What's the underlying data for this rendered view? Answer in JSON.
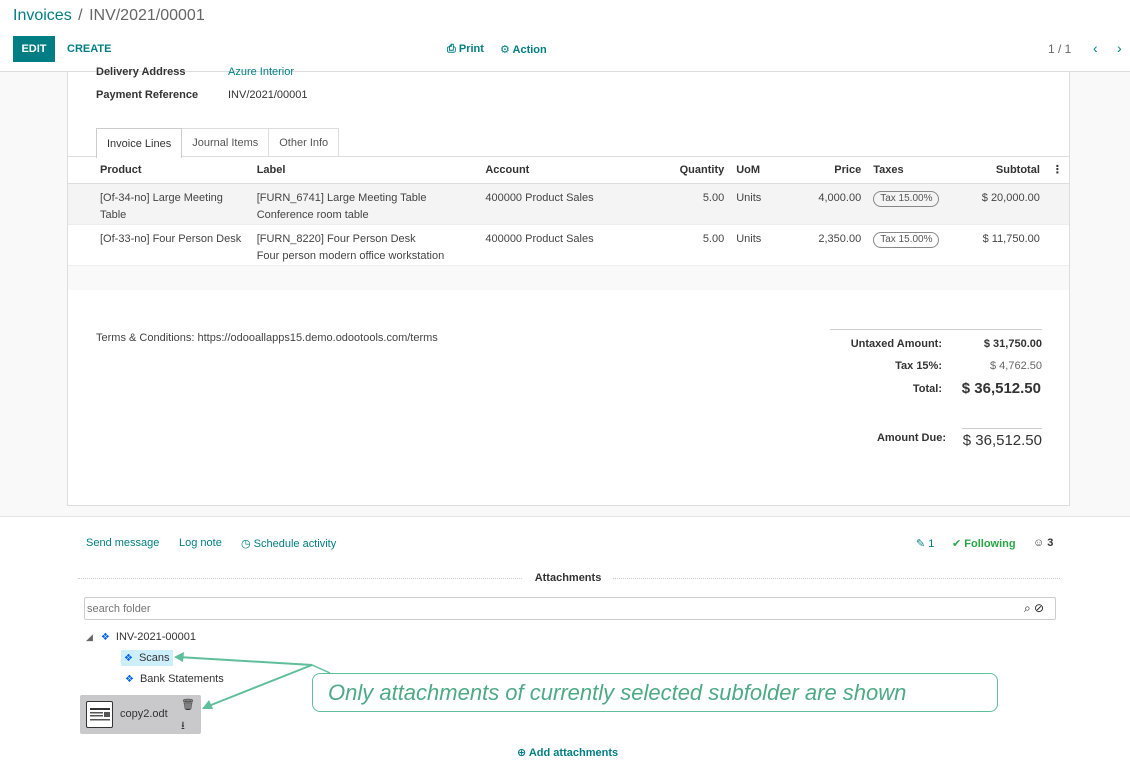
{
  "breadcrumb": {
    "parent": "Invoices",
    "sep": "/",
    "current": "INV/2021/00001"
  },
  "toolbar": {
    "edit": "EDIT",
    "create": "CREATE",
    "print": "⎙ Print",
    "action": "⚙ Action"
  },
  "pager": {
    "text": "1 / 1",
    "prev": "‹",
    "next": "›"
  },
  "fields": {
    "delivery_label": "Delivery Address",
    "delivery_value": "Azure Interior",
    "payref_label": "Payment Reference",
    "payref_value": "INV/2021/00001"
  },
  "tabs": [
    "Invoice Lines",
    "Journal Items",
    "Other Info"
  ],
  "columns": {
    "product": "Product",
    "label": "Label",
    "account": "Account",
    "quantity": "Quantity",
    "uom": "UoM",
    "price": "Price",
    "taxes": "Taxes",
    "subtotal": "Subtotal",
    "more": "⋮"
  },
  "lines": [
    {
      "product": "[Of-34-no] Large Meeting Table",
      "label1": "[FURN_6741] Large Meeting Table",
      "label2": "Conference room table",
      "account": "400000 Product Sales",
      "quantity": "5.00",
      "uom": "Units",
      "price": "4,000.00",
      "tax": "Tax 15.00%",
      "subtotal": "$ 20,000.00"
    },
    {
      "product": "[Of-33-no] Four Person Desk",
      "label1": "[FURN_8220] Four Person Desk",
      "label2": "Four person modern office workstation",
      "account": "400000 Product Sales",
      "quantity": "5.00",
      "uom": "Units",
      "price": "2,350.00",
      "tax": "Tax 15.00%",
      "subtotal": "$ 11,750.00"
    }
  ],
  "terms": "Terms & Conditions: https://odooallapps15.demo.odootools.com/terms",
  "totals": {
    "untaxed_label": "Untaxed Amount:",
    "untaxed_value": "$ 31,750.00",
    "tax_label": "Tax 15%:",
    "tax_value": "$ 4,762.50",
    "total_label": "Total:",
    "total_value": "$ 36,512.50",
    "due_label": "Amount Due:",
    "due_value": "$ 36,512.50"
  },
  "chatter": {
    "send_message": "Send message",
    "log_note": "Log note",
    "schedule_activity": "◷ Schedule activity",
    "attachments_count": "✎ 1",
    "following": "✔ Following",
    "followers": "☺ 3"
  },
  "attachments": {
    "title": "Attachments",
    "search_placeholder": "search folder",
    "search_icons": "⌕ ⊘",
    "root": "INV-2021-00001",
    "children": [
      "Scans",
      "Bank Statements"
    ],
    "file_name": "copy2.odt",
    "add_label": "⊕ Add attachments"
  },
  "callout": "Only attachments of currently selected subfolder are shown",
  "colors": {
    "accent": "#017e84",
    "green": "#28a745",
    "callout": "#5fbf9a"
  }
}
